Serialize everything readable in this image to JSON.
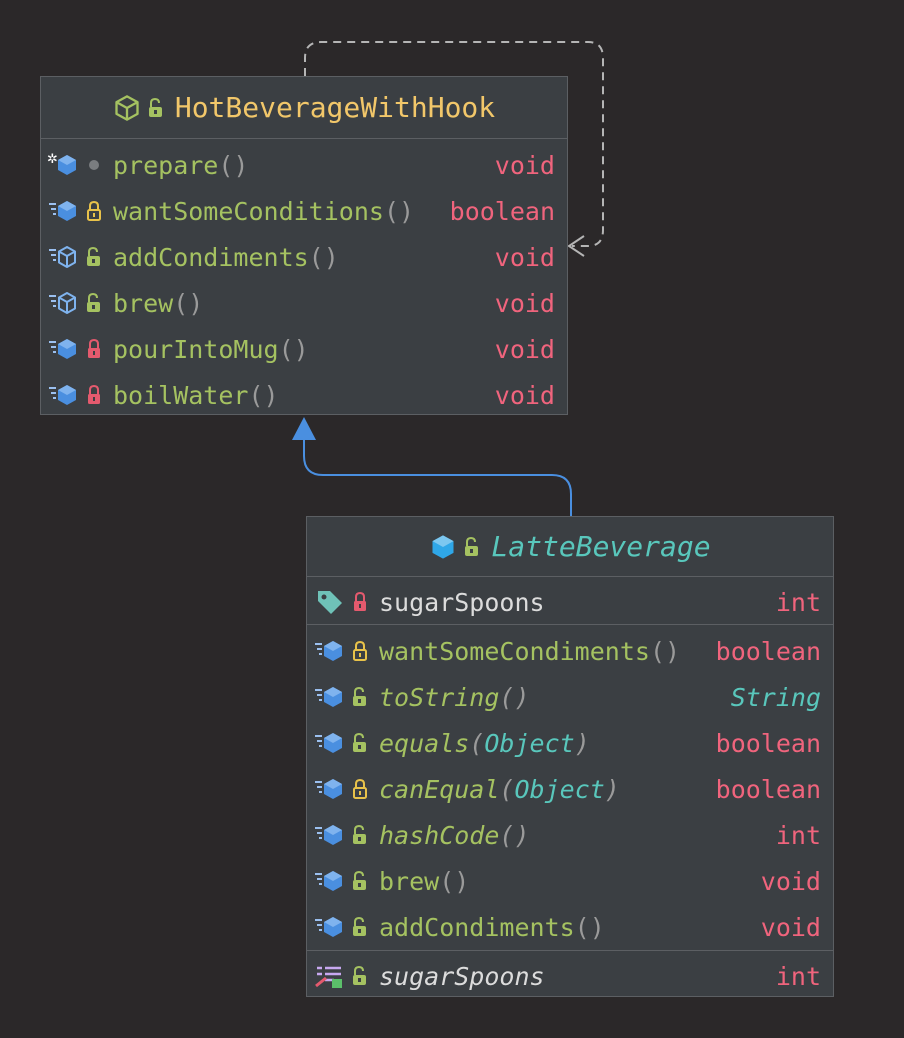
{
  "colors": {
    "background": "#2b2829",
    "box": "#3b3f43",
    "border": "#5c5f63",
    "class_name": "#f2c76a",
    "abstract_class_name": "#59c7bc",
    "method_name": "#a5c261",
    "field_name": "#dcdcdc",
    "type": "#f0647d",
    "object_type": "#59c7bc",
    "inheritance_arrow": "#4a8fe0",
    "dependency_arrow": "#b5b5b5"
  },
  "hot_beverage": {
    "name": "HotBeverageWithHook",
    "class_icon": "class-icon",
    "class_visibility_icon": "unlocked-icon",
    "methods": [
      {
        "name": "prepare",
        "params": "",
        "type": "void",
        "icon": "final-method-icon",
        "visibility": "package-dot-icon"
      },
      {
        "name": "wantSomeConditions",
        "params": "",
        "type": "boolean",
        "icon": "method-icon",
        "visibility": "protected-lock-icon"
      },
      {
        "name": "addCondiments",
        "params": "",
        "type": "void",
        "icon": "abstract-method-icon",
        "visibility": "public-lock-icon"
      },
      {
        "name": "brew",
        "params": "",
        "type": "void",
        "icon": "abstract-method-icon",
        "visibility": "public-lock-icon"
      },
      {
        "name": "pourIntoMug",
        "params": "",
        "type": "void",
        "icon": "method-icon",
        "visibility": "private-lock-icon"
      },
      {
        "name": "boilWater",
        "params": "",
        "type": "void",
        "icon": "method-icon",
        "visibility": "private-lock-icon"
      }
    ]
  },
  "latte_beverage": {
    "name": "LatteBeverage",
    "class_icon": "class-icon",
    "class_visibility_icon": "unlocked-icon",
    "fields": [
      {
        "name": "sugarSpoons",
        "type": "int",
        "icon": "field-tag-icon",
        "visibility": "private-lock-icon"
      }
    ],
    "methods": [
      {
        "name": "wantSomeCondiments",
        "params": "",
        "type": "boolean",
        "icon": "method-icon",
        "visibility": "protected-lock-icon",
        "italic": false
      },
      {
        "name": "toString",
        "params": "",
        "type": "String",
        "icon": "method-icon",
        "visibility": "public-lock-icon",
        "italic": true
      },
      {
        "name": "equals",
        "params": "Object",
        "type": "boolean",
        "icon": "method-icon",
        "visibility": "public-lock-icon",
        "italic": true
      },
      {
        "name": "canEqual",
        "params": "Object",
        "type": "boolean",
        "icon": "method-icon",
        "visibility": "protected-lock-icon",
        "italic": true
      },
      {
        "name": "hashCode",
        "params": "",
        "type": "int",
        "icon": "method-icon",
        "visibility": "public-lock-icon",
        "italic": true
      },
      {
        "name": "brew",
        "params": "",
        "type": "void",
        "icon": "method-icon",
        "visibility": "public-lock-icon",
        "italic": false
      },
      {
        "name": "addCondiments",
        "params": "",
        "type": "void",
        "icon": "method-icon",
        "visibility": "public-lock-icon",
        "italic": false
      }
    ],
    "properties": [
      {
        "name": "sugarSpoons",
        "type": "int",
        "icon": "property-icon",
        "visibility": "public-lock-icon"
      }
    ]
  }
}
